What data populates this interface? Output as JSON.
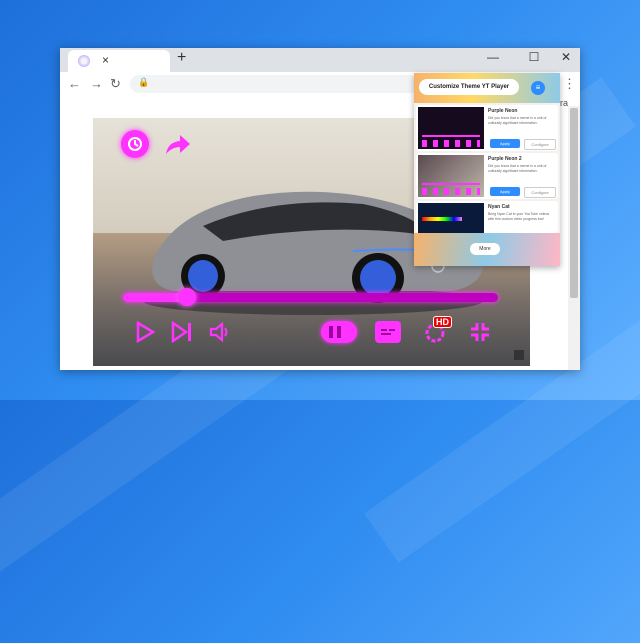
{
  "browser": {
    "tab_close": "×",
    "new_tab": "+",
    "minimize": "—",
    "maximize": "☐",
    "close": "✕",
    "back": "←",
    "forward": "→",
    "reload": "↻",
    "lock": "🔒",
    "menu": "⋮",
    "page_side_text": "ura"
  },
  "player": {
    "seek_progress": 0.17,
    "accent_color": "#ff33ff",
    "hd_badge": "HD"
  },
  "popup": {
    "title": "Customize Theme YT Player",
    "menu_icon": "≡",
    "cards": [
      {
        "title": "Purple Neon",
        "desc": "Did you know that a meme is a unit of culturally significant information.",
        "apply": "Apply",
        "configure": "Configure"
      },
      {
        "title": "Purple Neon 2",
        "desc": "Did you know that a meme is a unit of culturally significant information.",
        "apply": "Apply",
        "configure": "Configure"
      },
      {
        "title": "Nyan Cat",
        "desc": "Bring Nyan Cat to your YouTube videos with this custom video progress bar!",
        "apply": "",
        "configure": ""
      }
    ],
    "more_label": "More"
  }
}
